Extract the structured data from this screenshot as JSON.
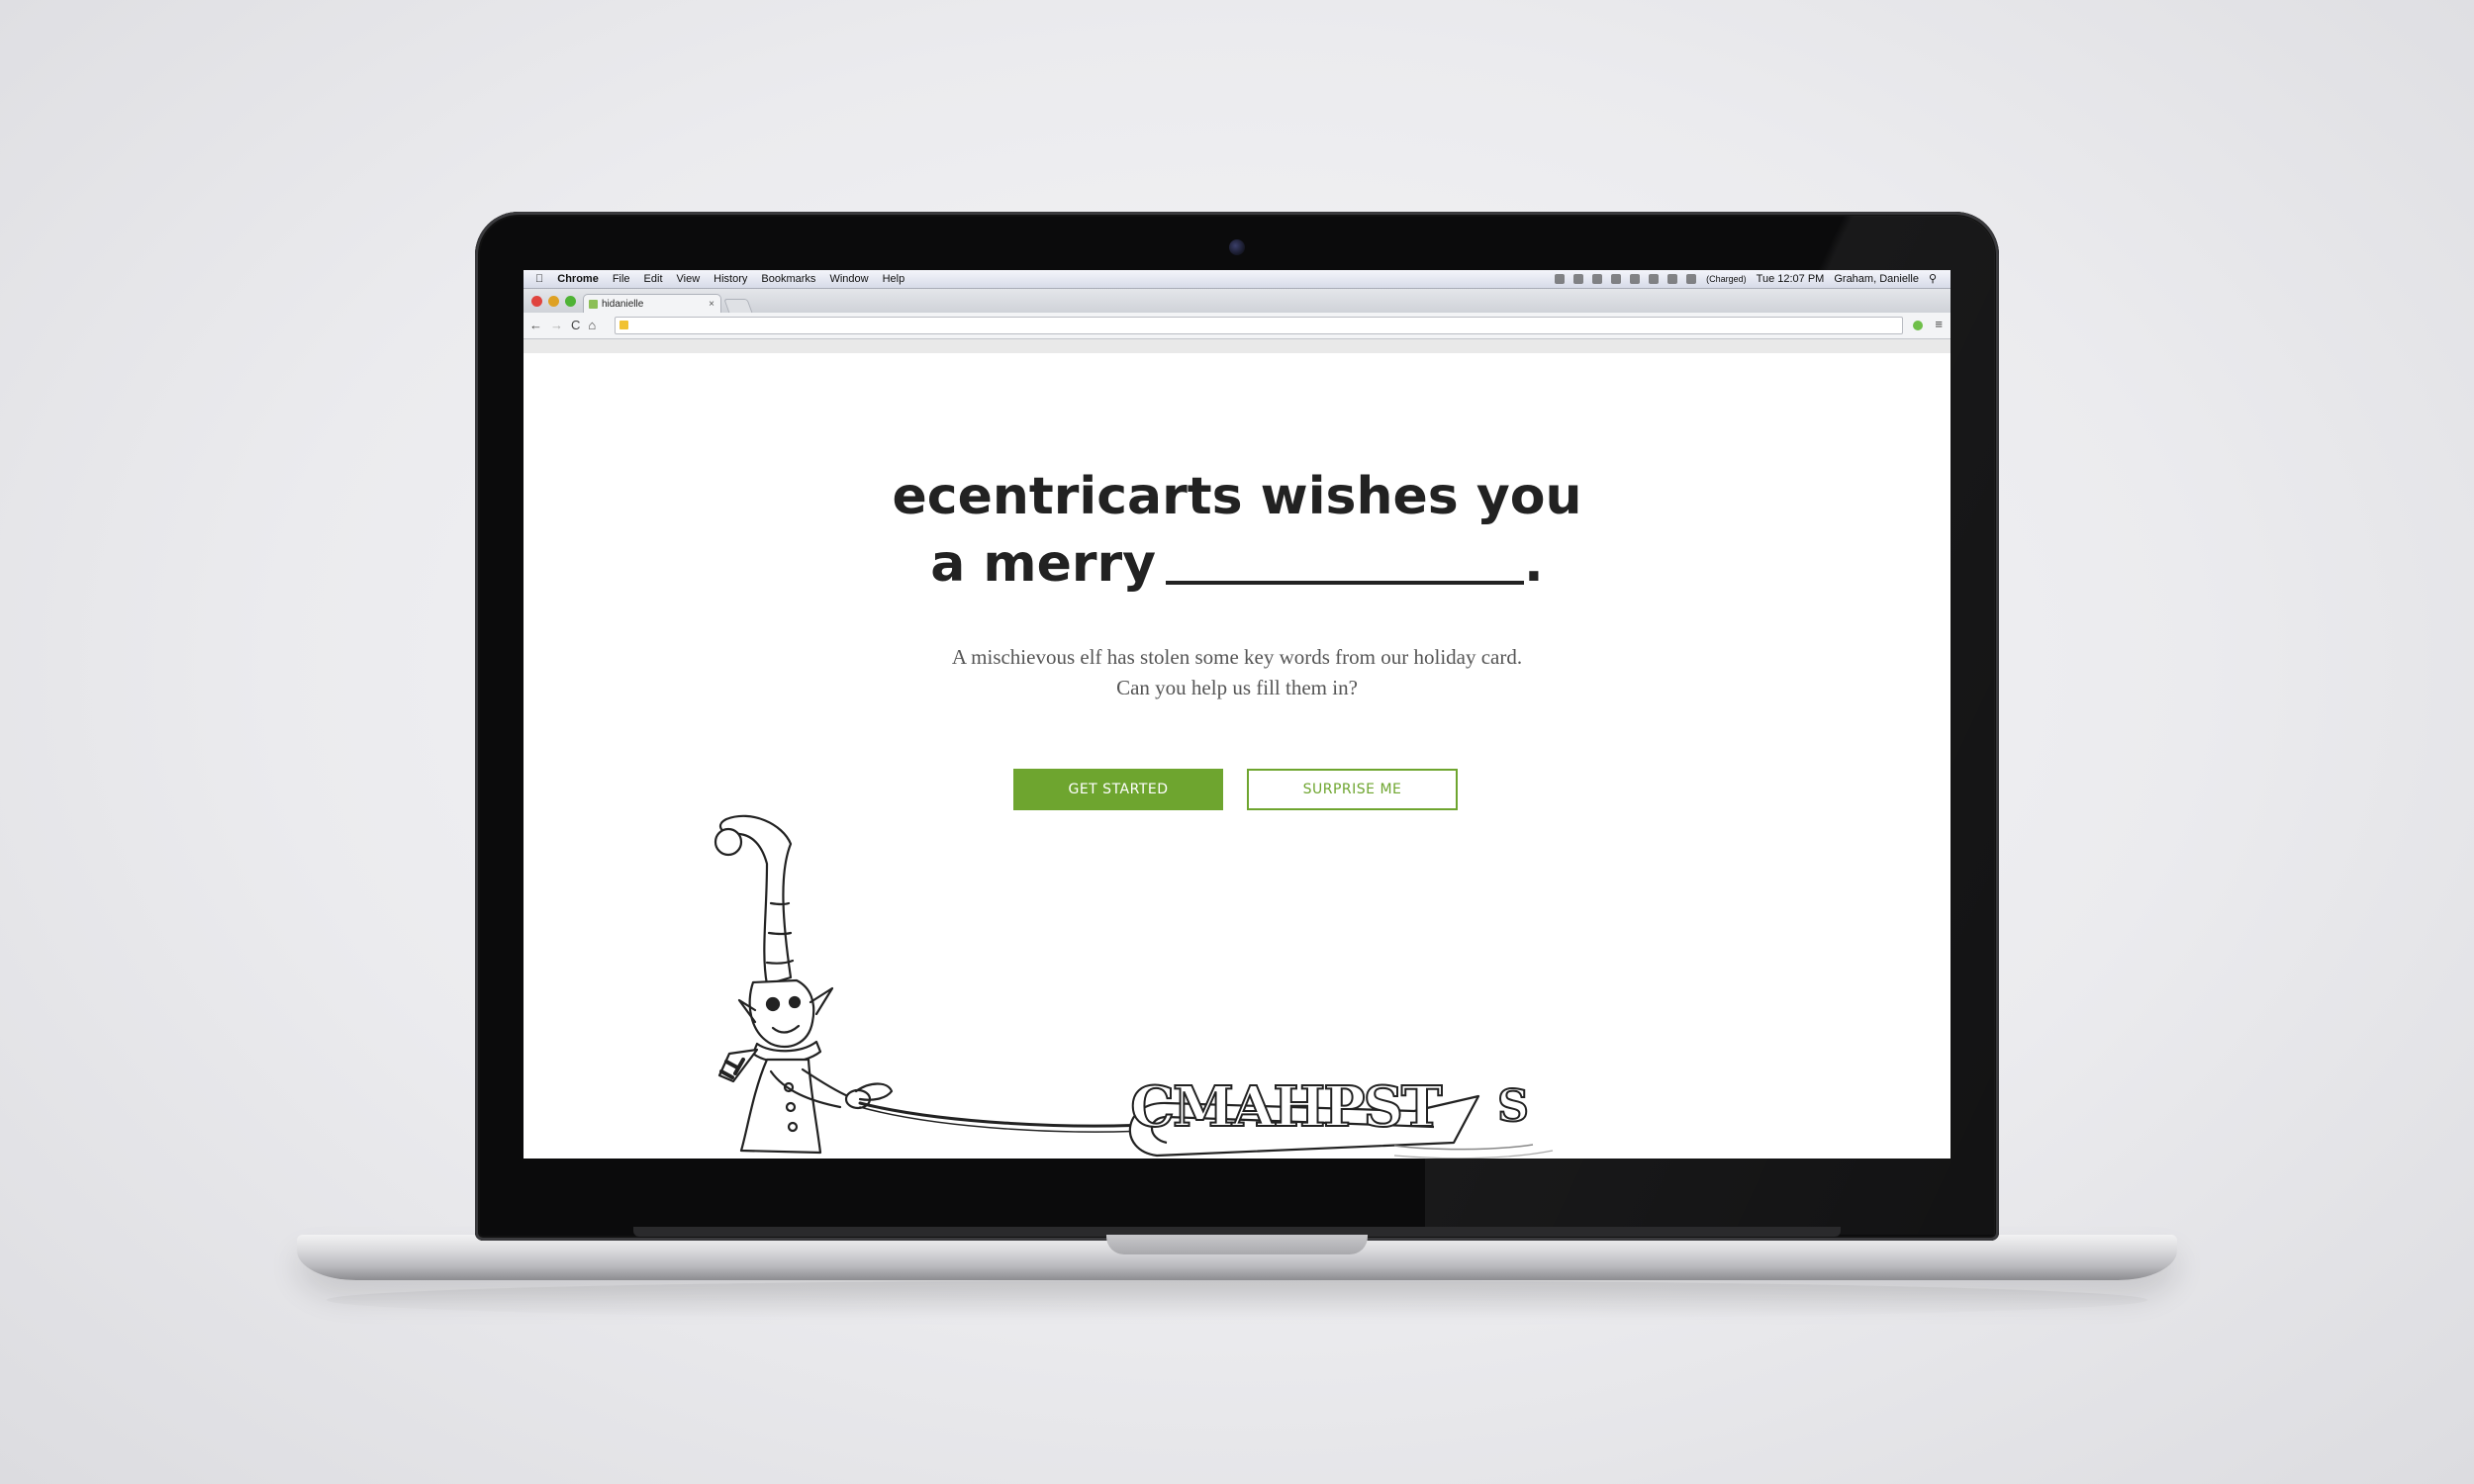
{
  "menubar": {
    "app": "Chrome",
    "menus": [
      "File",
      "Edit",
      "View",
      "History",
      "Bookmarks",
      "Window",
      "Help"
    ],
    "battery": "(Charged)",
    "clock": "Tue 12:07 PM",
    "user": "Graham, Danielle"
  },
  "browser": {
    "tab_title": "hidanielle",
    "tab_close": "×",
    "nav": {
      "back": "←",
      "forward": "→",
      "reload": "C",
      "home": "⌂"
    },
    "menu_icon": "≡"
  },
  "page": {
    "headline_line1": "ecentricarts wishes you",
    "headline_line2": "a merry",
    "headline_period": ".",
    "sub_line1": "A mischievous elf has stolen some key words from our holiday card.",
    "sub_line2": "Can you help us fill them in?",
    "primary_button": "GET STARTED",
    "secondary_button": "SURPRISE ME",
    "sled_letters": "CMAHPST",
    "trailing_letter": "S"
  },
  "colors": {
    "accent": "#6ea52f",
    "text": "#222222",
    "subtext": "#555555"
  },
  "icons": [
    "apple-icon",
    "wifi-icon",
    "battery-icon",
    "search-icon",
    "favicon-icon",
    "close-icon",
    "back-icon",
    "forward-icon",
    "reload-icon",
    "home-icon",
    "extension-icon",
    "menu-icon"
  ]
}
